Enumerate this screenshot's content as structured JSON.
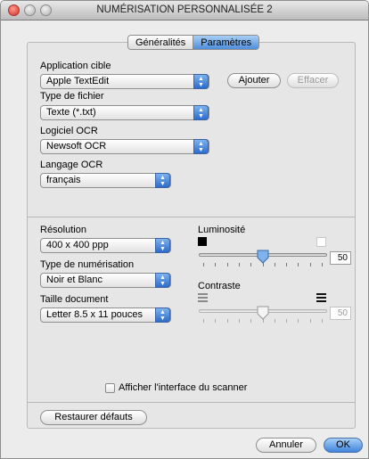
{
  "window": {
    "title": "NUMÉRISATION PERSONNALISÉE 2"
  },
  "tabs": [
    {
      "label": "Généralités",
      "active": false
    },
    {
      "label": "Paramètres",
      "active": true
    }
  ],
  "app": {
    "label": "Application cible",
    "value": "Apple TextEdit",
    "add_label": "Ajouter",
    "delete_label": "Effacer"
  },
  "file_type": {
    "label": "Type de fichier",
    "value": "Texte (*.txt)"
  },
  "ocr_software": {
    "label": "Logiciel OCR",
    "value": "Newsoft OCR"
  },
  "ocr_language": {
    "label": "Langage OCR",
    "value": "français"
  },
  "resolution": {
    "label": "Résolution",
    "value": "400 x 400 ppp"
  },
  "scan_type": {
    "label": "Type de numérisation",
    "value": "Noir et Blanc"
  },
  "doc_size": {
    "label": "Taille document",
    "value": "Letter  8.5 x 11 pouces"
  },
  "brightness": {
    "label": "Luminosité",
    "value": "50",
    "level": 0.5,
    "enabled": true
  },
  "contrast": {
    "label": "Contraste",
    "value": "50",
    "level": 0.5,
    "enabled": false
  },
  "scanner_ui": {
    "label": "Afficher l'interface du scanner",
    "checked": false
  },
  "restore_label": "Restaurer défauts",
  "cancel_label": "Annuler",
  "ok_label": "OK",
  "colors": {
    "accent": "#3f84dc",
    "close": "#d62f23"
  }
}
